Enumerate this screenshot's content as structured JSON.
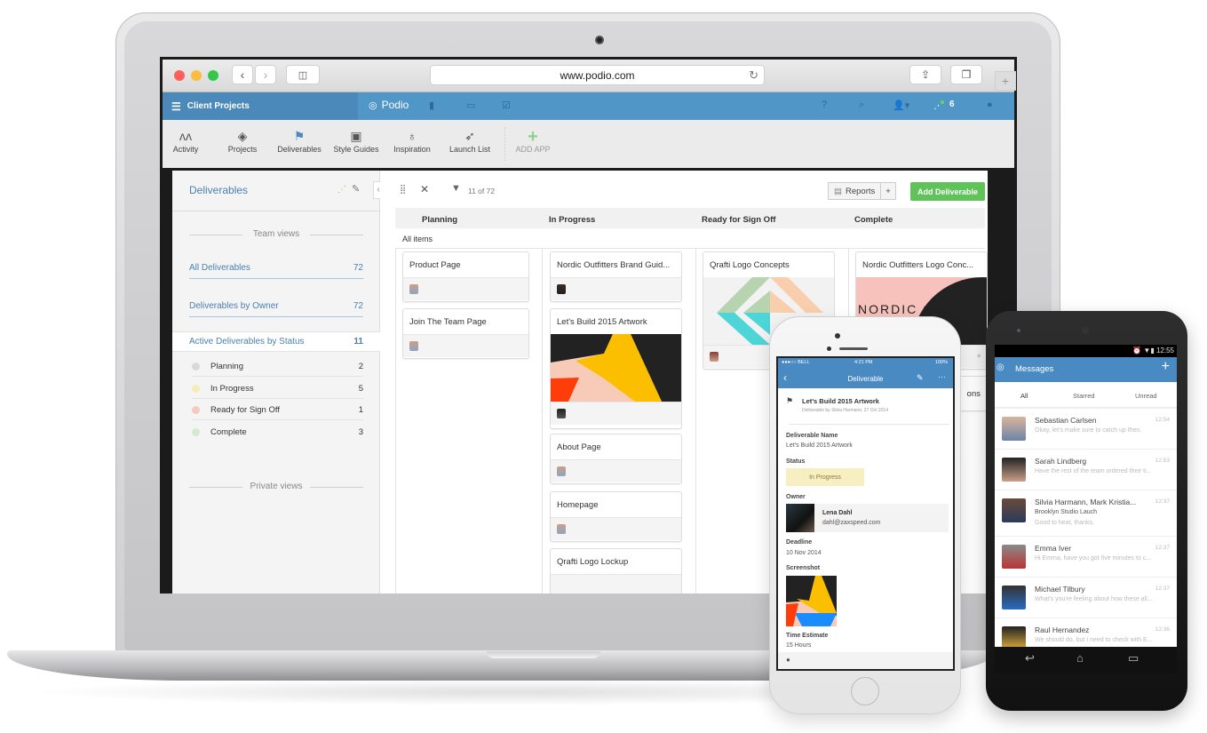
{
  "browser": {
    "url": "www.podio.com",
    "icons": [
      "back-icon",
      "forward-icon",
      "sidebar-icon",
      "reload-icon",
      "share-icon",
      "tabs-icon",
      "new-tab-icon"
    ]
  },
  "header": {
    "workspace": "Client Projects",
    "brand": "Podio",
    "notification_count": "6",
    "icons": [
      "menu-icon",
      "podio-logo-icon",
      "contacts-icon",
      "calendar-icon",
      "tasks-icon",
      "help-icon",
      "search-icon",
      "user-icon",
      "activity-stream-icon",
      "chat-icon"
    ]
  },
  "apps": [
    {
      "label": "Activity",
      "icon": "activity-icon"
    },
    {
      "label": "Projects",
      "icon": "diamond-icon"
    },
    {
      "label": "Deliverables",
      "icon": "flag-icon"
    },
    {
      "label": "Style Guides",
      "icon": "toolbox-icon"
    },
    {
      "label": "Inspiration",
      "icon": "lightbulb-icon"
    },
    {
      "label": "Launch List",
      "icon": "rocket-icon"
    },
    {
      "label": "ADD APP",
      "icon": "plus-icon"
    }
  ],
  "sidebar": {
    "title": "Deliverables",
    "team_views_label": "Team views",
    "views": [
      {
        "label": "All Deliverables",
        "count": "72"
      },
      {
        "label": "Deliverables by Owner",
        "count": "72"
      }
    ],
    "active_view": {
      "label": "Active Deliverables by Status",
      "count": "11"
    },
    "statuses": [
      {
        "label": "Planning",
        "count": "2",
        "color": "#d9d9d9"
      },
      {
        "label": "In Progress",
        "count": "5",
        "color": "#f5ecb8"
      },
      {
        "label": "Ready for Sign Off",
        "count": "1",
        "color": "#f8c9bd"
      },
      {
        "label": "Complete",
        "count": "3",
        "color": "#d4ebd2"
      }
    ],
    "private_views_label": "Private views"
  },
  "toolbar": {
    "filter_count": "11 of 72",
    "reports_label": "Reports",
    "plus_label": "+",
    "add_label": "Add Deliverable"
  },
  "board": {
    "columns": [
      "Planning",
      "In Progress",
      "Ready for Sign Off",
      "Complete"
    ],
    "group_label": "All items",
    "planning": [
      "Product Page",
      "Join The Team Page"
    ],
    "in_progress": [
      "Nordic Outfitters Brand Guid...",
      "Let's Build 2015 Artwork",
      "About Page",
      "Homepage",
      "Qrafti Logo Lockup"
    ],
    "ready": [
      "Qrafti Logo Concepts"
    ],
    "complete": [
      "Nordic Outfitters Logo Conc..."
    ],
    "complete_partial": "ons",
    "image_text": "NORDIC OUTFITTERS"
  },
  "iphone": {
    "carrier": "●●●○○ BELL",
    "time": "4:21 PM",
    "battery": "100%",
    "title": "Deliverable",
    "item_title": "Let's Build 2015 Artwork",
    "item_sub": "Deliverable by Silvia Harmann, 27 Oct 2014",
    "fields": {
      "name_label": "Deliverable Name",
      "name_value": "Let's Build 2015 Artwork",
      "status_label": "Status",
      "status_value": "In Progress",
      "owner_label": "Owner",
      "owner_name": "Lena Dahl",
      "owner_email": "dahl@zaxspeed.com",
      "deadline_label": "Deadline",
      "deadline_value": "10 Nov 2014",
      "screenshot_label": "Screenshot",
      "time_label": "Time Estimate",
      "time_value": "15 Hours"
    }
  },
  "android": {
    "time": "12:55",
    "title": "Messages",
    "tabs": [
      "All",
      "Starred",
      "Unread"
    ],
    "messages": [
      {
        "name": "Sebastian Carlsen",
        "time": "12:54",
        "preview": "Okay, let's make sure to catch up then."
      },
      {
        "name": "Sarah Lindberg",
        "time": "12:53",
        "preview": "Have the rest of the team ordered their ti..."
      },
      {
        "name": "Silvia Harmann, Mark Kristia...",
        "time": "12:37",
        "subject": "Brooklyn Studio Lauch",
        "preview": "Good to hear, thanks."
      },
      {
        "name": "Emma Iver",
        "time": "12:37",
        "preview": "Hi Emma, have you got five minutes to c..."
      },
      {
        "name": "Michael Tilbury",
        "time": "12:37",
        "preview": "What's you're feeling about how these all..."
      },
      {
        "name": "Raul Hernandez",
        "time": "12:36",
        "preview": "We should do, but I need to check with E..."
      }
    ]
  }
}
